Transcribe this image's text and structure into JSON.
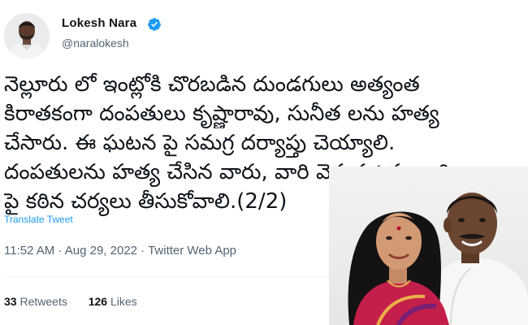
{
  "tweet": {
    "author": {
      "name": "Lokesh Nara",
      "handle": "@naralokesh",
      "verified": true
    },
    "text_lines": [
      "నెల్లూరు లో ఇంట్లోకి చొరబడిన దుండగులు అత్యంత",
      "కిరాతకంగా దంపతులు కృష్ణారావు, సునీత లను హత్య",
      "చేసారు. ఈ ఘటన పై సమగ్ర దర్యాప్తు చెయ్యాలి.",
      "దంపతులను హత్య చేసిన వారు, వారి వెనుక ఉన్న వారి",
      "పై కఠిన చర్యలు తీసుకోవాలి.(2/2)"
    ],
    "translate_label": "Translate Tweet",
    "timestamp": "11:52 AM · Aug 29, 2022 · Twitter Web App",
    "retweets": {
      "count": "33",
      "label": "Retweets"
    },
    "likes": {
      "count": "126",
      "label": "Likes"
    }
  },
  "colors": {
    "link": "#1d9bf0",
    "verified": "#1d9bf0",
    "secondary_text": "#536471"
  },
  "icons": {
    "verified": "verified-badge-icon"
  }
}
